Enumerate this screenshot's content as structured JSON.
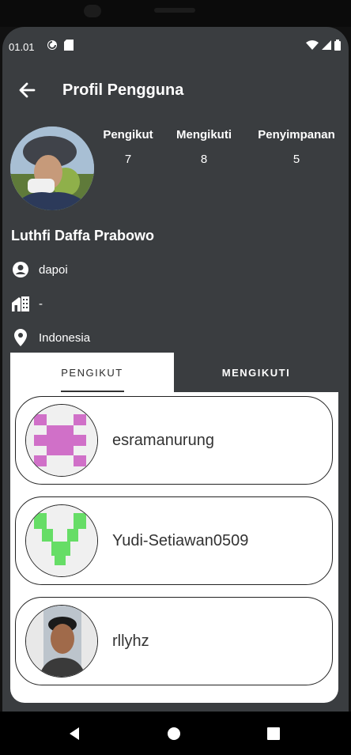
{
  "status_bar": {
    "time": "01.01"
  },
  "app_bar": {
    "title": "Profil Pengguna",
    "back_icon": "arrow-left-icon"
  },
  "profile": {
    "name": "Luthfi Daffa Prabowo",
    "username": "dapoi",
    "company": "-",
    "location": "Indonesia",
    "stats": [
      {
        "label": "Pengikut",
        "value": "7"
      },
      {
        "label": "Mengikuti",
        "value": "8"
      },
      {
        "label": "Penyimpanan",
        "value": "5"
      }
    ]
  },
  "tabs": {
    "followers": "PENGIKUT",
    "following": "MENGIKUTI"
  },
  "followers": [
    {
      "username": "esramanurung",
      "avatar_color": "#d070c8"
    },
    {
      "username": "Yudi-Setiawan0509",
      "avatar_color": "#66dd66"
    },
    {
      "username": "rllyhz"
    }
  ],
  "colors": {
    "background": "#3a3d40",
    "card_border": "#222222",
    "text_light": "#ffffff"
  }
}
